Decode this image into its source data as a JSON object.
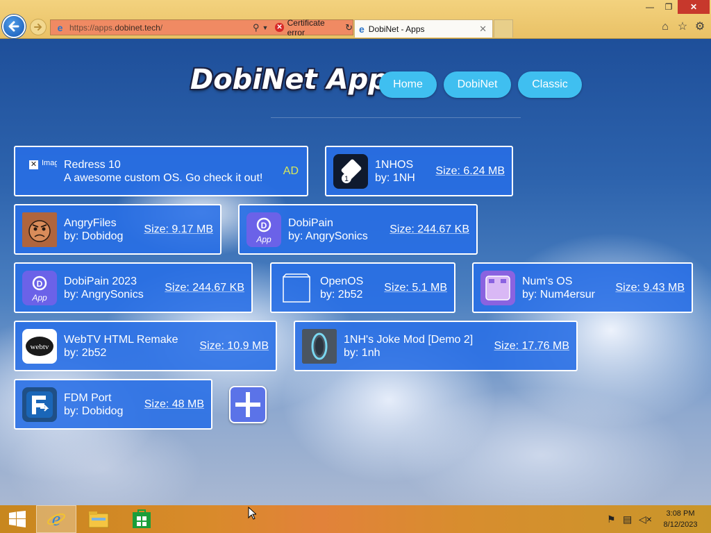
{
  "browser": {
    "url_prefix": "https://apps.",
    "url_domain": "dobinet.tech",
    "url_suffix": "/",
    "cert_error": "Certificate error",
    "tab_title": "DobiNet - Apps",
    "window_controls": {
      "minimize": "—",
      "restore": "❐",
      "close": "✕"
    }
  },
  "site": {
    "logo_text": "DobiNet Apps",
    "nav": [
      "Home",
      "DobiNet",
      "Classic"
    ]
  },
  "ad": {
    "image_alt": "Image",
    "title": "Redress 10",
    "description": "A awesome custom OS. Go check it out!",
    "badge": "AD"
  },
  "apps": [
    {
      "name": "1NHOS",
      "author": "by: 1NH",
      "size": "Size: 6.24 MB",
      "icon": "1nhos-icon"
    },
    {
      "name": "AngryFiles",
      "author": "by: Dobidog",
      "size": "Size: 9.17 MB",
      "icon": "angryfiles-icon"
    },
    {
      "name": "DobiPain",
      "author": "by: AngrySonics",
      "size": "Size: 244.67 KB",
      "icon": "dobipain-icon"
    },
    {
      "name": "DobiPain 2023",
      "author": "by: AngrySonics",
      "size": "Size: 244.67 KB",
      "icon": "dobipain-2023-icon"
    },
    {
      "name": "OpenOS",
      "author": "by: 2b52",
      "size": "Size: 5.1 MB",
      "icon": "openos-icon"
    },
    {
      "name": "Num's OS",
      "author": "by: Num4ersur",
      "size": "Size: 9.43 MB",
      "icon": "nums-os-icon"
    },
    {
      "name": "WebTV HTML Remake",
      "author": "by: 2b52",
      "size": "Size: 10.9 MB",
      "icon": "webtv-icon"
    },
    {
      "name": "1NH's Joke Mod [Demo 2]",
      "author": "by: 1nh",
      "size": "Size: 17.76 MB",
      "icon": "joke-mod-icon"
    },
    {
      "name": "FDM Port",
      "author": "by: Dobidog",
      "size": "Size: 48 MB",
      "icon": "fdm-port-icon"
    }
  ],
  "icon_labels": {
    "webtv": "webtv",
    "dobipain": "App",
    "onenh": "1"
  },
  "taskbar": {
    "time": "3:08 PM",
    "date": "8/12/2023"
  },
  "colors": {
    "card_bg": "#2a6ee6",
    "nav_button": "#3fbff0",
    "ad_badge": "#d8e85a",
    "address_bar_error": "#f08a63"
  }
}
